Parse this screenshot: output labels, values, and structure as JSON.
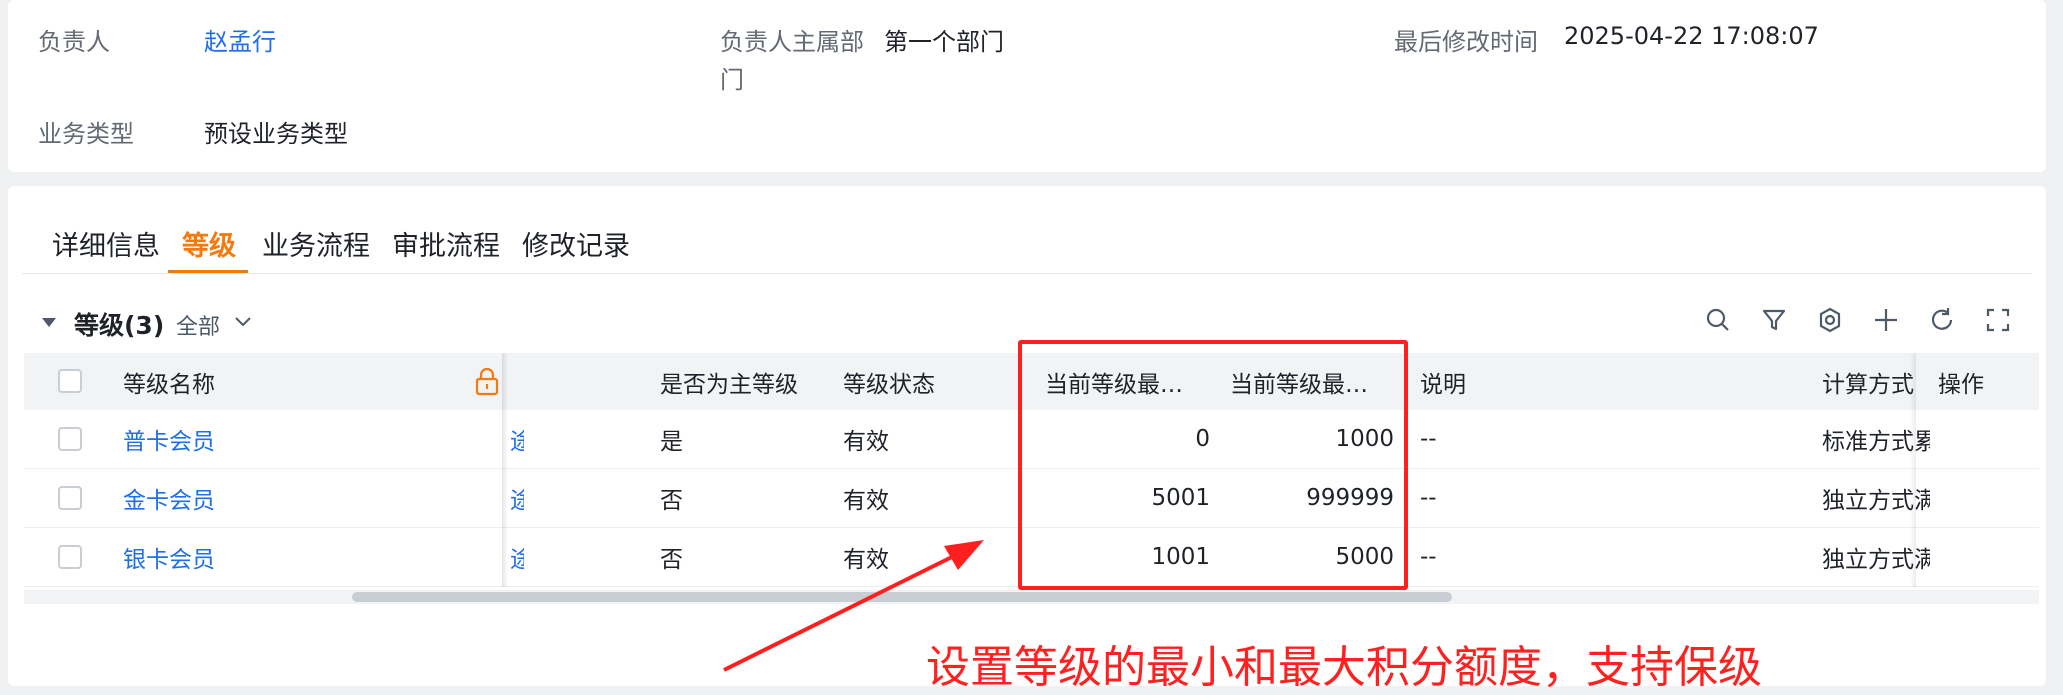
{
  "info": {
    "owner_label": "负责人",
    "owner_value": "赵孟行",
    "dept_label_line1": "负责人主属部",
    "dept_label_line2": "门",
    "dept_value": "第一个部门",
    "modified_label": "最后修改时间",
    "modified_value": "2025-04-22 17:08:07",
    "biztype_label": "业务类型",
    "biztype_value": "预设业务类型"
  },
  "tabs": [
    {
      "label": "详细信息",
      "active": false
    },
    {
      "label": "等级",
      "active": true
    },
    {
      "label": "业务流程",
      "active": false
    },
    {
      "label": "审批流程",
      "active": false
    },
    {
      "label": "修改记录",
      "active": false
    }
  ],
  "section": {
    "title": "等级(3)",
    "filter_label": "全部"
  },
  "toolbar_icons": [
    "search-icon",
    "filter-icon",
    "settings-icon",
    "add-icon",
    "refresh-icon",
    "fullscreen-icon"
  ],
  "table": {
    "columns": {
      "name": "等级名称",
      "is_main": "是否为主等级",
      "status": "等级状态",
      "min": "当前等级最…",
      "max": "当前等级最…",
      "desc": "说明",
      "calc": "计算方式",
      "ops": "操作"
    },
    "rows": [
      {
        "name": "普卡会员",
        "partial": "途",
        "is_main": "是",
        "status": "有效",
        "min": "0",
        "max": "1000",
        "desc": "--",
        "calc": "标准方式累"
      },
      {
        "name": "金卡会员",
        "partial": "途",
        "is_main": "否",
        "status": "有效",
        "min": "5001",
        "max": "999999",
        "desc": "--",
        "calc": "独立方式满"
      },
      {
        "name": "银卡会员",
        "partial": "途",
        "is_main": "否",
        "status": "有效",
        "min": "1001",
        "max": "5000",
        "desc": "--",
        "calc": "独立方式满"
      }
    ]
  },
  "annotation": {
    "text": "设置等级的最小和最大积分额度，支持保级",
    "color": "#ff2020"
  },
  "colors": {
    "accent": "#f37a0d",
    "link": "#1e6fe8",
    "annotation": "#ff1f1f"
  }
}
